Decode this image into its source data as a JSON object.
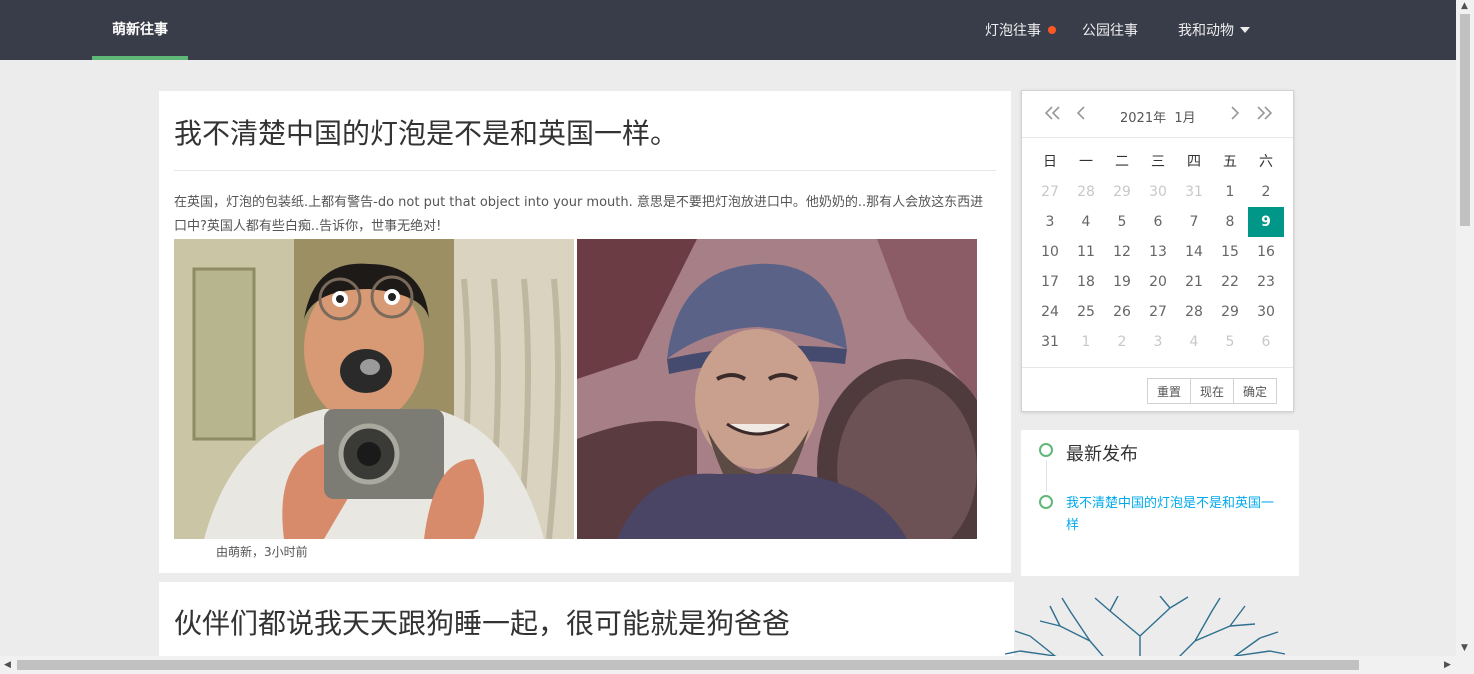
{
  "nav": {
    "brand": "萌新往事",
    "items": [
      {
        "label": "灯泡往事",
        "has_dot": true
      },
      {
        "label": "公园往事"
      },
      {
        "label": "我和动物",
        "has_caret": true
      }
    ],
    "active_color": "#5fb878",
    "dot_color": "#ff5722"
  },
  "post1": {
    "title": "我不清楚中国的灯泡是不是和英国一样。",
    "body": "在英国，灯泡的包装纸.上都有警告-do not put that object into your mouth. 意思是不要把灯泡放进口中。他奶奶的..那有人会放这东西进口中?英国人都有些白痴..告诉你，世事无绝对!",
    "byline": "由萌新，3小时前"
  },
  "post2": {
    "title": "伙伴们都说我天天跟狗睡一起，很可能就是狗爸爸"
  },
  "calendar": {
    "year_label": "2021年",
    "month_label": "1月",
    "weekdays": [
      "日",
      "一",
      "二",
      "三",
      "四",
      "五",
      "六"
    ],
    "weeks": [
      [
        "27",
        "28",
        "29",
        "30",
        "31",
        "1",
        "2"
      ],
      [
        "3",
        "4",
        "5",
        "6",
        "7",
        "8",
        "9"
      ],
      [
        "10",
        "11",
        "12",
        "13",
        "14",
        "15",
        "16"
      ],
      [
        "17",
        "18",
        "19",
        "20",
        "21",
        "22",
        "23"
      ],
      [
        "24",
        "25",
        "26",
        "27",
        "28",
        "29",
        "30"
      ],
      [
        "31",
        "1",
        "2",
        "3",
        "4",
        "5",
        "6"
      ]
    ],
    "selected": "9",
    "selected_color": "#009688",
    "buttons": {
      "reset": "重置",
      "now": "现在",
      "confirm": "确定"
    }
  },
  "timeline": {
    "heading": "最新发布",
    "items": [
      "我不清楚中国的灯泡是不是和英国一样"
    ],
    "link_color": "#01aaed"
  }
}
